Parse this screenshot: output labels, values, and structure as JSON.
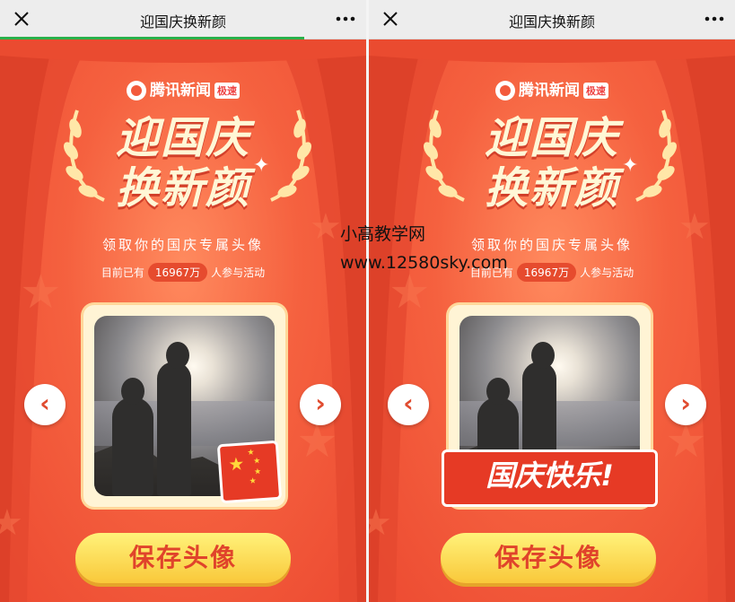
{
  "left": {
    "title": "迎国庆换新颜",
    "brand_name": "腾讯新闻",
    "brand_tag": "极速",
    "headline_line1": "迎国庆",
    "headline_line2": "换新颜",
    "subtitle": "领取你的国庆专属头像",
    "count_prefix": "目前已有",
    "count_value": "16967万",
    "count_suffix": "人参与活动",
    "save_label": "保存头像",
    "progress_pct": 83
  },
  "right": {
    "title": "迎国庆换新颜",
    "brand_name": "腾讯新闻",
    "brand_tag": "极速",
    "headline_line1": "迎国庆",
    "headline_line2": "换新颜",
    "subtitle": "领取你的国庆专属头像",
    "count_prefix": "目前已有",
    "count_value": "16967万",
    "count_suffix": "人参与活动",
    "banner_text": "国庆快乐!",
    "save_label": "保存头像"
  },
  "watermark": {
    "line1": "小高教学网",
    "line2": "www.12580sky.com"
  },
  "colors": {
    "background": "#f35a3c",
    "accent_yellow": "#f9c83a",
    "text_red": "#e0432b",
    "progress_green": "#2ab14b"
  },
  "icons": {
    "close": "close-icon",
    "more": "more-icon",
    "prev": "chevron-left-icon",
    "next": "chevron-right-icon",
    "flag": "china-flag-icon"
  }
}
